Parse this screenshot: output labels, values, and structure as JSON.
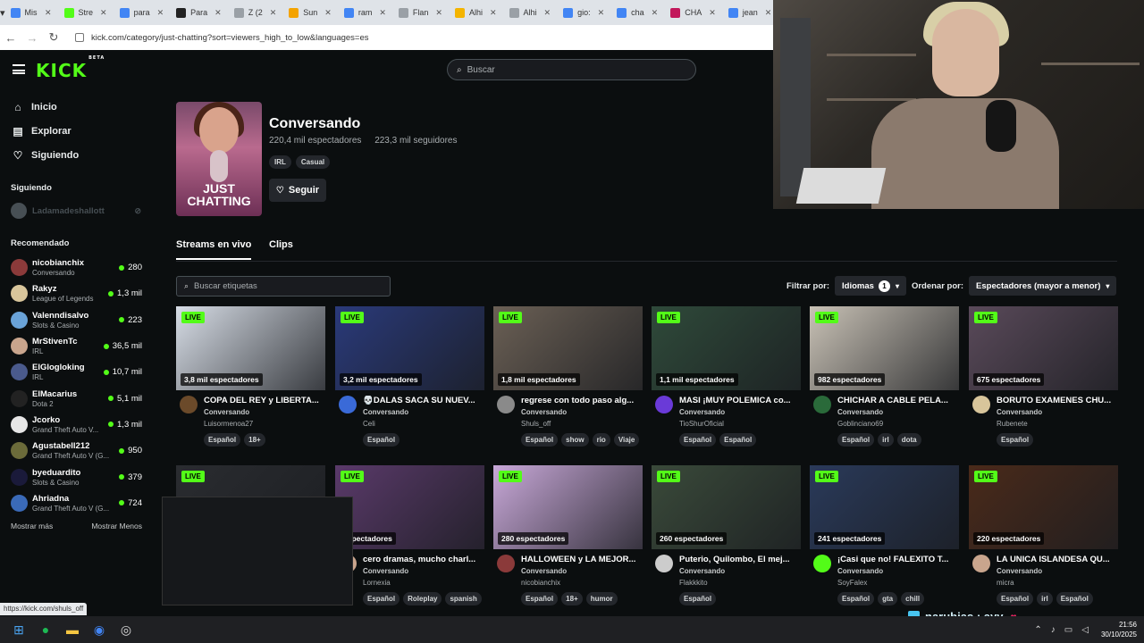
{
  "browser": {
    "tabs": [
      {
        "label": "Mis",
        "color": "#4285f4"
      },
      {
        "label": "Stre",
        "color": "#53fc18"
      },
      {
        "label": "para",
        "color": "#4285f4"
      },
      {
        "label": "Para",
        "color": "#222222"
      },
      {
        "label": "Z (2",
        "color": "#9aa0a6"
      },
      {
        "label": "Sun",
        "color": "#f4a300"
      },
      {
        "label": "ram",
        "color": "#4285f4"
      },
      {
        "label": "Flan",
        "color": "#9aa0a6"
      },
      {
        "label": "Alhi",
        "color": "#f4b400"
      },
      {
        "label": "Alhi",
        "color": "#9aa0a6"
      },
      {
        "label": "gio:",
        "color": "#4285f4"
      },
      {
        "label": "cha",
        "color": "#4285f4"
      },
      {
        "label": "CHA",
        "color": "#c2185b"
      },
      {
        "label": "jean",
        "color": "#4285f4"
      }
    ],
    "url": "kick.com/category/just-chatting?sort=viewers_high_to_low&languages=es",
    "status_url": "https://kick.com/shuls_off"
  },
  "topnav": {
    "logo": "KICK",
    "logo_badge": "BETA",
    "search_placeholder": "Buscar"
  },
  "sidebar": {
    "nav": [
      {
        "label": "Inicio",
        "icon": "home-icon",
        "glyph": "⌂"
      },
      {
        "label": "Explorar",
        "icon": "compass-icon",
        "glyph": "▤"
      },
      {
        "label": "Siguiendo",
        "icon": "heart-icon",
        "glyph": "♡"
      }
    ],
    "following_heading": "Siguiendo",
    "following": [
      {
        "name": "Ladamadeshallott"
      }
    ],
    "recommended_heading": "Recomendado",
    "recommended": [
      {
        "name": "nicobianchix",
        "category": "Conversando",
        "viewers": "280",
        "color": "#8b3a3a"
      },
      {
        "name": "Rakyz",
        "category": "League of Legends",
        "viewers": "1,3 mil",
        "color": "#d8c59b"
      },
      {
        "name": "Valenndisalvo",
        "category": "Slots & Casino",
        "viewers": "223",
        "color": "#6aa3d8"
      },
      {
        "name": "MrStivenTc",
        "category": "IRL",
        "viewers": "36,5 mil",
        "color": "#c9a58d"
      },
      {
        "name": "ElGlogloking",
        "category": "IRL",
        "viewers": "10,7 mil",
        "color": "#4a5a8c"
      },
      {
        "name": "ElMacarius",
        "category": "Dota 2",
        "viewers": "5,1 mil",
        "color": "#222222"
      },
      {
        "name": "Jcorko",
        "category": "Grand Theft Auto V...",
        "viewers": "1,3 mil",
        "color": "#e6e6e6"
      },
      {
        "name": "Agustabell212",
        "category": "Grand Theft Auto V (G...",
        "viewers": "950",
        "color": "#6b6b3a"
      },
      {
        "name": "byeduardito",
        "category": "Slots & Casino",
        "viewers": "379",
        "color": "#1a1a3a"
      },
      {
        "name": "Ahriadna",
        "category": "Grand Theft Auto V (G...",
        "viewers": "724",
        "color": "#3a6ab8"
      }
    ],
    "show_more": "Mostrar más",
    "show_less": "Mostrar Menos"
  },
  "category": {
    "title": "Conversando",
    "viewers": "220,4 mil espectadores",
    "followers": "223,3 mil seguidores",
    "tags": [
      "IRL",
      "Casual"
    ],
    "follow_label": "Seguir",
    "cover_text": "JUST CHATTING"
  },
  "tabs": [
    {
      "label": "Streams en vivo",
      "active": true
    },
    {
      "label": "Clips",
      "active": false
    }
  ],
  "filters": {
    "tag_search_placeholder": "Buscar etiquetas",
    "filter_by": "Filtrar por:",
    "languages": "Idiomas",
    "languages_count": "1",
    "sort_by": "Ordenar por:",
    "sort_value": "Espectadores (mayor a menor)"
  },
  "streams": [
    {
      "title": "COPA DEL REY y LIBERTA...",
      "category": "Conversando",
      "user": "Luisormenoa27",
      "viewers": "3,8 mil espectadores",
      "tags": [
        "Español",
        "18+"
      ],
      "thumb": "#d7dde6",
      "av": "#6b4a2a"
    },
    {
      "title": "💀DALAS SACA SU NUEV...",
      "category": "Conversando",
      "user": "Celi",
      "viewers": "3,2 mil espectadores",
      "tags": [
        "Español"
      ],
      "thumb": "#2a3a7a",
      "av": "#3a6ad8"
    },
    {
      "title": "regrese con todo paso alg...",
      "category": "Conversando",
      "user": "Shuls_off",
      "viewers": "1,8 mil espectadores",
      "tags": [
        "Español",
        "show",
        "rio",
        "Viaje"
      ],
      "thumb": "#6b6055",
      "av": "#8a8a8a"
    },
    {
      "title": "MASI ¡MUY POLEMICA co...",
      "category": "Conversando",
      "user": "TioShurOficial",
      "viewers": "1,1 mil espectadores",
      "tags": [
        "Español",
        "Español"
      ],
      "thumb": "#2f4a3a",
      "av": "#6a3ad8"
    },
    {
      "title": "CHICHAR A CABLE PELA...",
      "category": "Conversando",
      "user": "Goblinciano69",
      "viewers": "982 espectadores",
      "tags": [
        "Español",
        "irl",
        "dota"
      ],
      "thumb": "#c9c2b6",
      "av": "#2a6a3a"
    },
    {
      "title": "BORUTO EXAMENES CHU...",
      "category": "Conversando",
      "user": "Rubenete",
      "viewers": "675 espectadores",
      "tags": [
        "Español"
      ],
      "thumb": "#5a4a5a",
      "av": "#d8c59b"
    },
    {
      "title": "",
      "category": "",
      "user": "",
      "viewers": "",
      "tags": [],
      "thumb": "#2a2c30",
      "av": "#2a2c30"
    },
    {
      "title": "cero dramas, mucho charl...",
      "category": "Conversando",
      "user": "Lornexia",
      "viewers": "espectadores",
      "tags": [
        "Español",
        "Roleplay",
        "spanish"
      ],
      "thumb": "#5a3a6a",
      "av": "#c9a58d"
    },
    {
      "title": "HALLOWEEN y LA MEJOR...",
      "category": "Conversando",
      "user": "nicobianchix",
      "viewers": "280 espectadores",
      "tags": [
        "Español",
        "18+",
        "humor"
      ],
      "thumb": "#c8a8d8",
      "av": "#8b3a3a"
    },
    {
      "title": "Puterio, Quilombo, El mej...",
      "category": "Conversando",
      "user": "Flakkkito",
      "viewers": "260 espectadores",
      "tags": [
        "Español"
      ],
      "thumb": "#3a4a3a",
      "av": "#cccccc"
    },
    {
      "title": "¡Casi que no! FALEXITO T...",
      "category": "Conversando",
      "user": "SoyFalex",
      "viewers": "241 espectadores",
      "tags": [
        "Español",
        "gta",
        "chill"
      ],
      "thumb": "#2a3a5a",
      "av": "#53fc18"
    },
    {
      "title": "LA UNICA ISLANDESA QU...",
      "category": "Conversando",
      "user": "micra",
      "viewers": "220 espectadores",
      "tags": [
        "Español",
        "irl",
        "Español"
      ],
      "thumb": "#4a2a1a",
      "av": "#c9a58d"
    }
  ],
  "overlay": {
    "chat_user": "narubias",
    "chat_sep": ":",
    "chat_msg": "ayy"
  },
  "taskbar": {
    "time": "21:56",
    "date": "30/10/2025"
  }
}
